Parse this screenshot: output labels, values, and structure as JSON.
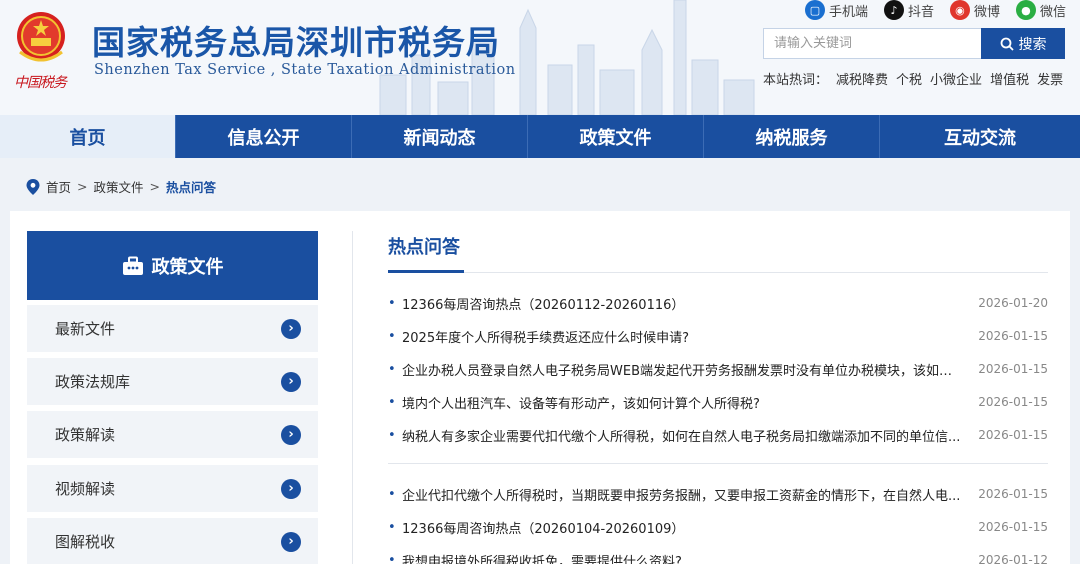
{
  "header": {
    "title_cn": "国家税务总局深圳市税务局",
    "title_en": "Shenzhen Tax Service , State Taxation Administration",
    "calligraphy": "中国税务",
    "top_links": [
      {
        "label": "手机端",
        "icon": "mobile-icon",
        "color": "#1a6fd0"
      },
      {
        "label": "抖音",
        "icon": "douyin-icon",
        "color": "#111111"
      },
      {
        "label": "微博",
        "icon": "weibo-icon",
        "color": "#e0362c"
      },
      {
        "label": "微信",
        "icon": "wechat-icon",
        "color": "#2aae43"
      }
    ],
    "search": {
      "placeholder": "请输入关键词",
      "button_label": "搜索"
    },
    "hot_label": "本站热词：",
    "hot_words": [
      "减税降费",
      "个税",
      "小微企业",
      "增值税",
      "发票"
    ]
  },
  "nav": {
    "items": [
      "首页",
      "信息公开",
      "新闻动态",
      "政策文件",
      "纳税服务",
      "互动交流"
    ],
    "active_index": 0
  },
  "breadcrumb": {
    "home": "首页",
    "sep": ">",
    "level1": "政策文件",
    "current": "热点问答"
  },
  "sidebar": {
    "heading": "政策文件",
    "items": [
      "最新文件",
      "政策法规库",
      "政策解读",
      "视频解读",
      "图解税收"
    ]
  },
  "main": {
    "title": "热点问答",
    "articles": [
      {
        "title": "12366每周咨询热点（20260112-20260116）",
        "date": "2026-01-20"
      },
      {
        "title": "2025年度个人所得税手续费返还应什么时候申请?",
        "date": "2026-01-15"
      },
      {
        "title": "企业办税人员登录自然人电子税务局WEB端发起代开劳务报酬发票时没有单位办税模块，该如何...",
        "date": "2026-01-15"
      },
      {
        "title": "境内个人出租汽车、设备等有形动产，该如何计算个人所得税?",
        "date": "2026-01-15"
      },
      {
        "title": "纳税人有多家企业需要代扣代缴个人所得税，如何在自然人电子税务局扣缴端添加不同的单位信...",
        "date": "2026-01-15"
      },
      {
        "title": "企业代扣代缴个人所得税时，当期既要申报劳务报酬，又要申报工资薪金的情形下，在自然人电...",
        "date": "2026-01-15"
      },
      {
        "title": "12366每周咨询热点（20260104-20260109）",
        "date": "2026-01-15"
      },
      {
        "title": "我想申报境外所得税收抵免，需要提供什么资料?",
        "date": "2026-01-12"
      }
    ]
  },
  "colors": {
    "brand_blue": "#1a4fa0",
    "accent_red": "#c8171e"
  }
}
